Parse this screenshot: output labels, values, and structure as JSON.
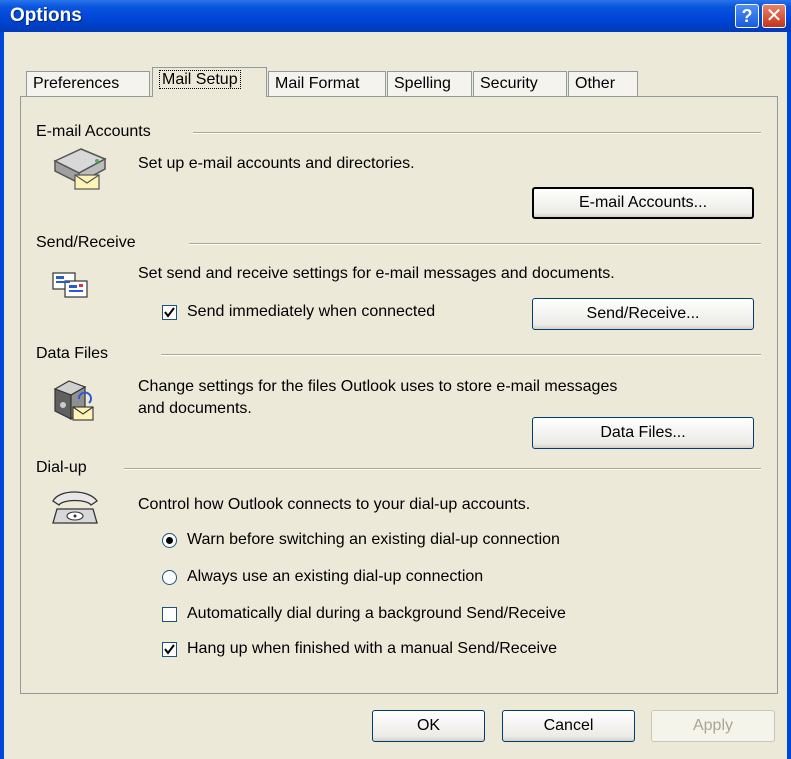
{
  "window": {
    "title": "Options"
  },
  "tabs": [
    "Preferences",
    "Mail Setup",
    "Mail Format",
    "Spelling",
    "Security",
    "Other"
  ],
  "active_tab": "Mail Setup",
  "email_accounts": {
    "heading": "E-mail Accounts",
    "description": "Set up e-mail accounts and directories.",
    "button": "E-mail Accounts...",
    "icon": "email-accounts-icon"
  },
  "send_receive": {
    "heading": "Send/Receive",
    "description": "Set send and receive settings for e-mail messages and documents.",
    "checkbox_label": "Send immediately when connected",
    "checkbox_checked": true,
    "button": "Send/Receive...",
    "icon": "send-receive-icon"
  },
  "data_files": {
    "heading": "Data Files",
    "description_line1": "Change settings for the files Outlook uses to store e-mail messages",
    "description_line2": "and documents.",
    "button": "Data Files...",
    "icon": "data-files-icon"
  },
  "dialup": {
    "heading": "Dial-up",
    "description": "Control how Outlook connects to your dial-up accounts.",
    "options": [
      {
        "label": "Warn before switching an existing dial-up connection",
        "type": "radio",
        "checked": true
      },
      {
        "label": "Always use an existing dial-up connection",
        "type": "radio",
        "checked": false
      },
      {
        "label": "Automatically dial during a background Send/Receive",
        "type": "checkbox",
        "checked": false
      },
      {
        "label": "Hang up when finished with a manual Send/Receive",
        "type": "checkbox",
        "checked": true
      }
    ],
    "icon": "telephone-icon"
  },
  "footer": {
    "ok": "OK",
    "cancel": "Cancel",
    "apply": "Apply"
  },
  "colors": {
    "titlebar": "#0046d8",
    "face": "#ece9d8",
    "border": "#919b9c"
  }
}
